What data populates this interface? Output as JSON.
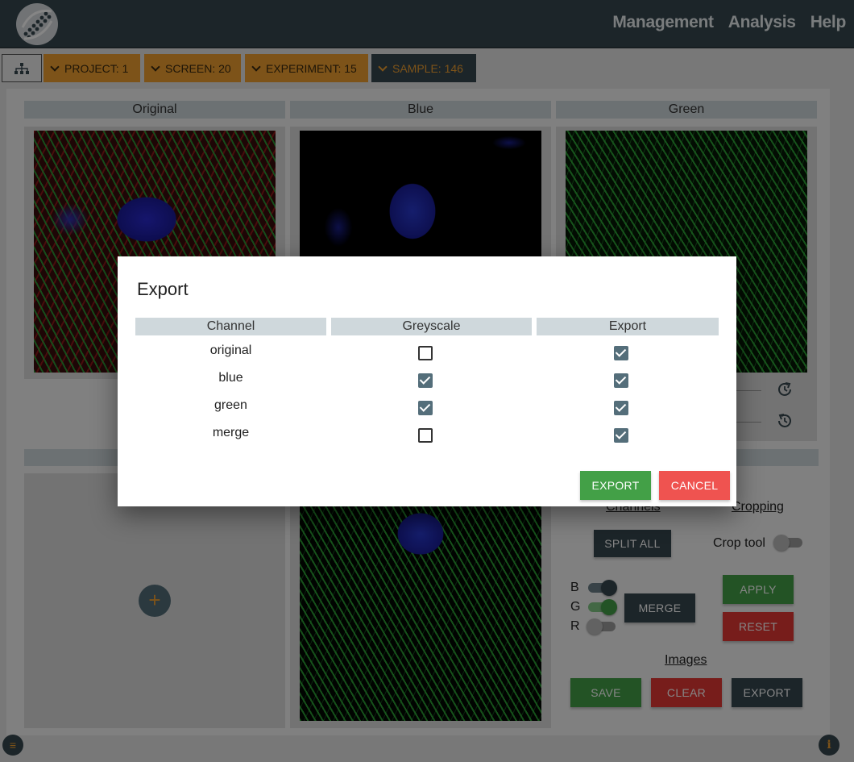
{
  "nav": {
    "logo_icon": "dna-logo-icon",
    "links": [
      "Management",
      "Analysis",
      "Help"
    ]
  },
  "breadcrumb": {
    "tree_icon": "hierarchy-icon",
    "items": [
      {
        "label": "PROJECT: 1"
      },
      {
        "label": "SCREEN: 20"
      },
      {
        "label": "EXPERIMENT: 15"
      },
      {
        "label": "SAMPLE: 146"
      }
    ],
    "colors": {
      "crumb": "#f0a030",
      "active": "#37474f"
    }
  },
  "panels": {
    "original": "Original",
    "blue": "Blue",
    "green": "Green"
  },
  "controls": {
    "channels_link": "Channels",
    "cropping_link": "Cropping",
    "split_all": "SPLIT ALL",
    "crop_tool_label": "Crop tool",
    "crop_tool_on": false,
    "channel_toggles": [
      {
        "label": "B",
        "on": true
      },
      {
        "label": "G",
        "on": true
      },
      {
        "label": "R",
        "on": false
      }
    ],
    "merge": "MERGE",
    "apply": "APPLY",
    "reset": "RESET",
    "images_link": "Images",
    "save": "SAVE",
    "clear": "CLEAR",
    "export": "EXPORT",
    "add_icon": "+",
    "menu_icon": "menu-icon",
    "info_icon": "info-icon"
  },
  "modal": {
    "title": "Export",
    "columns": [
      "Channel",
      "Greyscale",
      "Export"
    ],
    "rows": [
      {
        "channel": "original",
        "greyscale": false,
        "export": true
      },
      {
        "channel": "blue",
        "greyscale": true,
        "export": true
      },
      {
        "channel": "green",
        "greyscale": true,
        "export": true
      },
      {
        "channel": "merge",
        "greyscale": false,
        "export": true
      }
    ],
    "export_button": "EXPORT",
    "cancel_button": "CANCEL",
    "colors": {
      "export": "#43a047",
      "cancel": "#ef5350",
      "checkbox": "#546e7a"
    }
  }
}
